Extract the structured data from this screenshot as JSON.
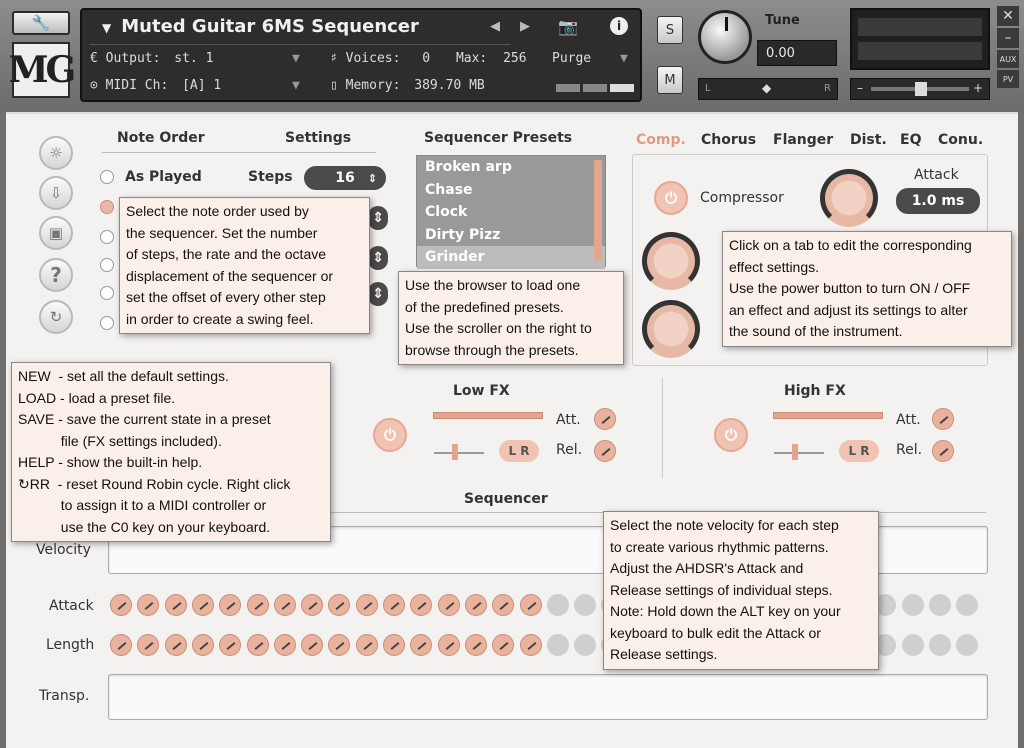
{
  "header": {
    "instrument_name": "Muted Guitar 6MS Sequencer",
    "output_label": "Output:",
    "output_value": "st. 1",
    "voices_label": "Voices:",
    "voices_value": "0",
    "max_label": "Max:",
    "max_value": "256",
    "purge_label": "Purge",
    "midi_label": "MIDI Ch:",
    "midi_value": "[A] 1",
    "memory_label": "Memory:",
    "memory_value": "389.70 MB",
    "solo_label": "S",
    "mute_label": "M",
    "tune_label": "Tune",
    "tune_value": "0.00",
    "pan_l": "L",
    "pan_r": "R",
    "aux_label": "AUX",
    "pv_label": "PV",
    "logo_text": "MG"
  },
  "left_tabs": {
    "note_order": "Note Order",
    "settings": "Settings"
  },
  "note_order": {
    "as_played": "As Played"
  },
  "settings": {
    "steps_label": "Steps",
    "steps_value": "16"
  },
  "presets": {
    "title": "Sequencer Presets",
    "items": [
      "Broken arp",
      "Chase",
      "Clock",
      "Dirty Pizz",
      "Grinder"
    ]
  },
  "fx_tabs": [
    "Comp.",
    "Chorus",
    "Flanger",
    "Dist.",
    "EQ",
    "Conu."
  ],
  "compressor": {
    "label": "Compressor",
    "attack_label": "Attack",
    "attack_value": "1.0 ms"
  },
  "low_fx": {
    "title": "Low FX",
    "att": "Att.",
    "rel": "Rel.",
    "lr": "L R"
  },
  "high_fx": {
    "title": "High FX",
    "att": "Att.",
    "rel": "Rel.",
    "lr": "L R"
  },
  "sequencer": {
    "title": "Sequencer",
    "velocity_label": "Velocity",
    "attack_label": "Attack",
    "length_label": "Length",
    "transp_label": "Transp."
  },
  "tooltips": {
    "note_order": "Select the note order used by\nthe sequencer. Set the number\nof steps, the rate and the octave\ndisplacement of the sequencer or\nset the offset of every other step\nin order to create a swing feel.",
    "presets": "Use the browser to load one\nof the predefined presets.\nUse the scroller on the right to\nbrowse through the presets.",
    "fx": "Click on a tab to edit the corresponding\neffect settings.\nUse the power button to turn ON / OFF\nan effect and adjust its settings to alter\nthe sound of the instrument.",
    "buttons": "NEW  - set all the default settings.\nLOAD - load a preset file.\nSAVE - save the current state in a preset\n           file (FX settings included).\nHELP - show the built-in help.\n↻RR  - reset Round Robin cycle. Right click\n           to assign it to a MIDI controller or\n           use the C0 key on your keyboard.",
    "sequencer": "Select the note velocity for each step\nto create various rhythmic patterns.\nAdjust the AHDSR's Attack and\nRelease settings of individual steps.\nNote: Hold down the ALT key on your\nkeyboard to bulk edit the Attack or\nRelease settings."
  }
}
